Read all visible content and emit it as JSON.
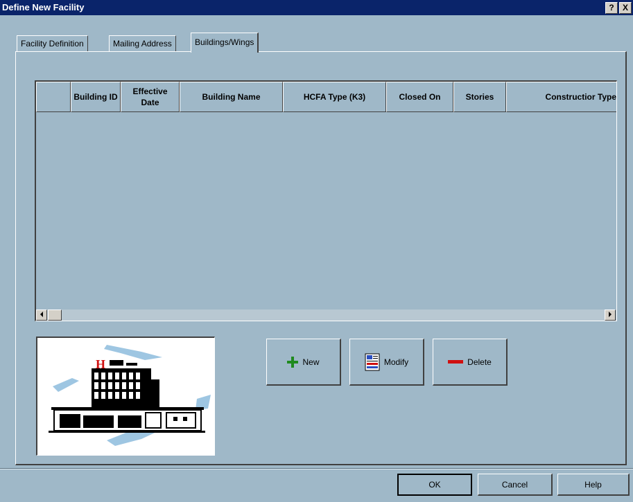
{
  "window": {
    "title": "Define New Facility",
    "help_button": "?",
    "close_button": "X"
  },
  "tabs": [
    {
      "label": "Facility Definition",
      "active": false
    },
    {
      "label": "Mailing Address",
      "active": false
    },
    {
      "label": "Buildings/Wings",
      "active": true
    }
  ],
  "grid": {
    "columns": [
      "",
      "Building ID",
      "Effective Date",
      "Building Name",
      "HCFA Type (K3)",
      "Closed On",
      "Stories",
      "Constructior Type"
    ],
    "rows": []
  },
  "actions": {
    "new_label": "New",
    "modify_label": "Modify",
    "delete_label": "Delete"
  },
  "footer": {
    "ok_label": "OK",
    "cancel_label": "Cancel",
    "help_label": "Help"
  },
  "colors": {
    "background": "#9fb8c8",
    "titlebar": "#0a246a",
    "new_icon": "#1f8a1f",
    "delete_icon": "#d01010"
  },
  "picture": {
    "sign_letter": "H"
  }
}
